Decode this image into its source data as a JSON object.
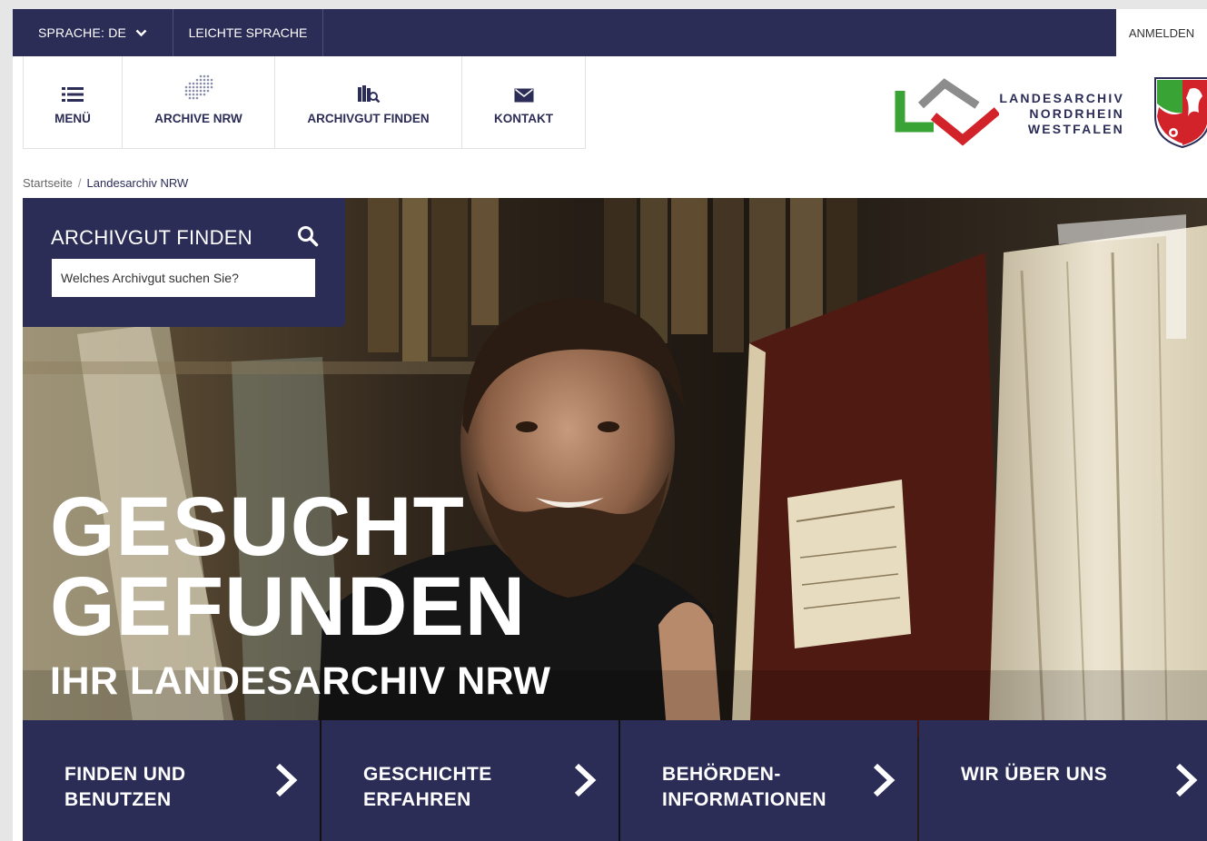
{
  "topbar": {
    "language_label": "SPRACHE: DE",
    "easy_language": "LEICHTE SPRACHE",
    "login": "ANMELDEN"
  },
  "nav": {
    "items": [
      {
        "label": "MENÜ",
        "icon": "menu-list-icon"
      },
      {
        "label": "ARCHIVE NRW",
        "icon": "nrw-map-icon"
      },
      {
        "label": "ARCHIVGUT FINDEN",
        "icon": "book-search-icon"
      },
      {
        "label": "KONTAKT",
        "icon": "envelope-icon"
      }
    ]
  },
  "logo": {
    "line1": "LANDESARCHIV",
    "line2": "NORDRHEIN",
    "line3": "WESTFALEN",
    "colors": {
      "green": "#3aa335",
      "red": "#d2232a",
      "grey": "#8c8c8c",
      "navy": "#2b2d57"
    }
  },
  "breadcrumb": {
    "home": "Startseite",
    "separator": "/",
    "current": "Landesarchiv NRW"
  },
  "search": {
    "title": "ARCHIVGUT FINDEN",
    "placeholder": "Welches Archivgut suchen Sie?"
  },
  "hero": {
    "line1": "GESUCHT",
    "line2": "GEFUNDEN",
    "subline": "IHR LANDESARCHIV NRW"
  },
  "tiles": [
    {
      "label": "FINDEN UND\nBENUTZEN"
    },
    {
      "label": "GESCHICHTE\nERFAHREN"
    },
    {
      "label": "BEHÖRDEN-\nINFORMATIONEN"
    },
    {
      "label": "WIR ÜBER UNS"
    }
  ],
  "colors": {
    "primary": "#2b2d57",
    "background": "#ffffff"
  }
}
